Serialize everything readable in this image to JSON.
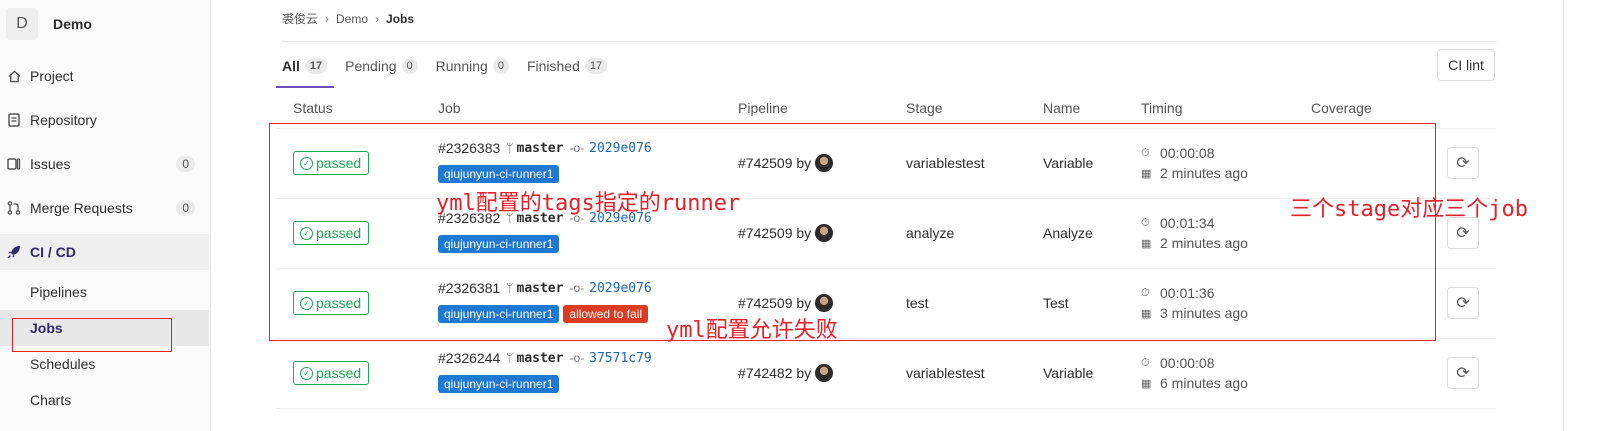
{
  "sidebar": {
    "project_initial": "D",
    "project_name": "Demo",
    "items": [
      {
        "label": "Project",
        "icon": "home-icon"
      },
      {
        "label": "Repository",
        "icon": "doc-icon"
      },
      {
        "label": "Issues",
        "icon": "issues-icon",
        "count": "0"
      },
      {
        "label": "Merge Requests",
        "icon": "merge-icon",
        "count": "0"
      },
      {
        "label": "CI / CD",
        "icon": "rocket-icon"
      }
    ],
    "subitems": [
      {
        "label": "Pipelines"
      },
      {
        "label": "Jobs"
      },
      {
        "label": "Schedules"
      },
      {
        "label": "Charts"
      }
    ]
  },
  "breadcrumb": [
    "裘俊云",
    "Demo",
    "Jobs"
  ],
  "tabs": [
    {
      "label": "All",
      "count": "17"
    },
    {
      "label": "Pending",
      "count": "0"
    },
    {
      "label": "Running",
      "count": "0"
    },
    {
      "label": "Finished",
      "count": "17"
    }
  ],
  "ci_lint_label": "CI lint",
  "table": {
    "headers": [
      "Status",
      "Job",
      "Pipeline",
      "Stage",
      "Name",
      "Timing",
      "Coverage"
    ],
    "rows": [
      {
        "status": "passed",
        "job_id": "#2326383",
        "branch": "master",
        "sha": "2029e076",
        "tag": "qiujunyun-ci-runner1",
        "pipeline": "#742509 by",
        "stage": "variablestest",
        "name": "Variable",
        "duration": "00:00:08",
        "finished": "2 minutes ago"
      },
      {
        "status": "passed",
        "job_id": "#2326382",
        "branch": "master",
        "sha": "2029e076",
        "tag": "qiujunyun-ci-runner1",
        "pipeline": "#742509 by",
        "stage": "analyze",
        "name": "Analyze",
        "duration": "00:01:34",
        "finished": "2 minutes ago"
      },
      {
        "status": "passed",
        "job_id": "#2326381",
        "branch": "master",
        "sha": "2029e076",
        "tag": "qiujunyun-ci-runner1",
        "extra_tag": "allowed to fail",
        "pipeline": "#742509 by",
        "stage": "test",
        "name": "Test",
        "duration": "00:01:36",
        "finished": "3 minutes ago"
      },
      {
        "status": "passed",
        "job_id": "#2326244",
        "branch": "master",
        "sha": "37571c79",
        "tag": "qiujunyun-ci-runner1",
        "pipeline": "#742482 by",
        "stage": "variablestest",
        "name": "Variable",
        "duration": "00:00:08",
        "finished": "6 minutes ago"
      }
    ]
  },
  "annotations": {
    "tags_runner": "yml配置的tags指定的runner",
    "allow_fail": "yml配置允许失败",
    "three_stage": "三个stage对应三个job"
  },
  "colors": {
    "annotation": "#e8202a",
    "passed": "#1aaa55",
    "tag": "#1f78d1",
    "fail_tag": "#db3b21",
    "sha_link": "#1b69b6"
  }
}
